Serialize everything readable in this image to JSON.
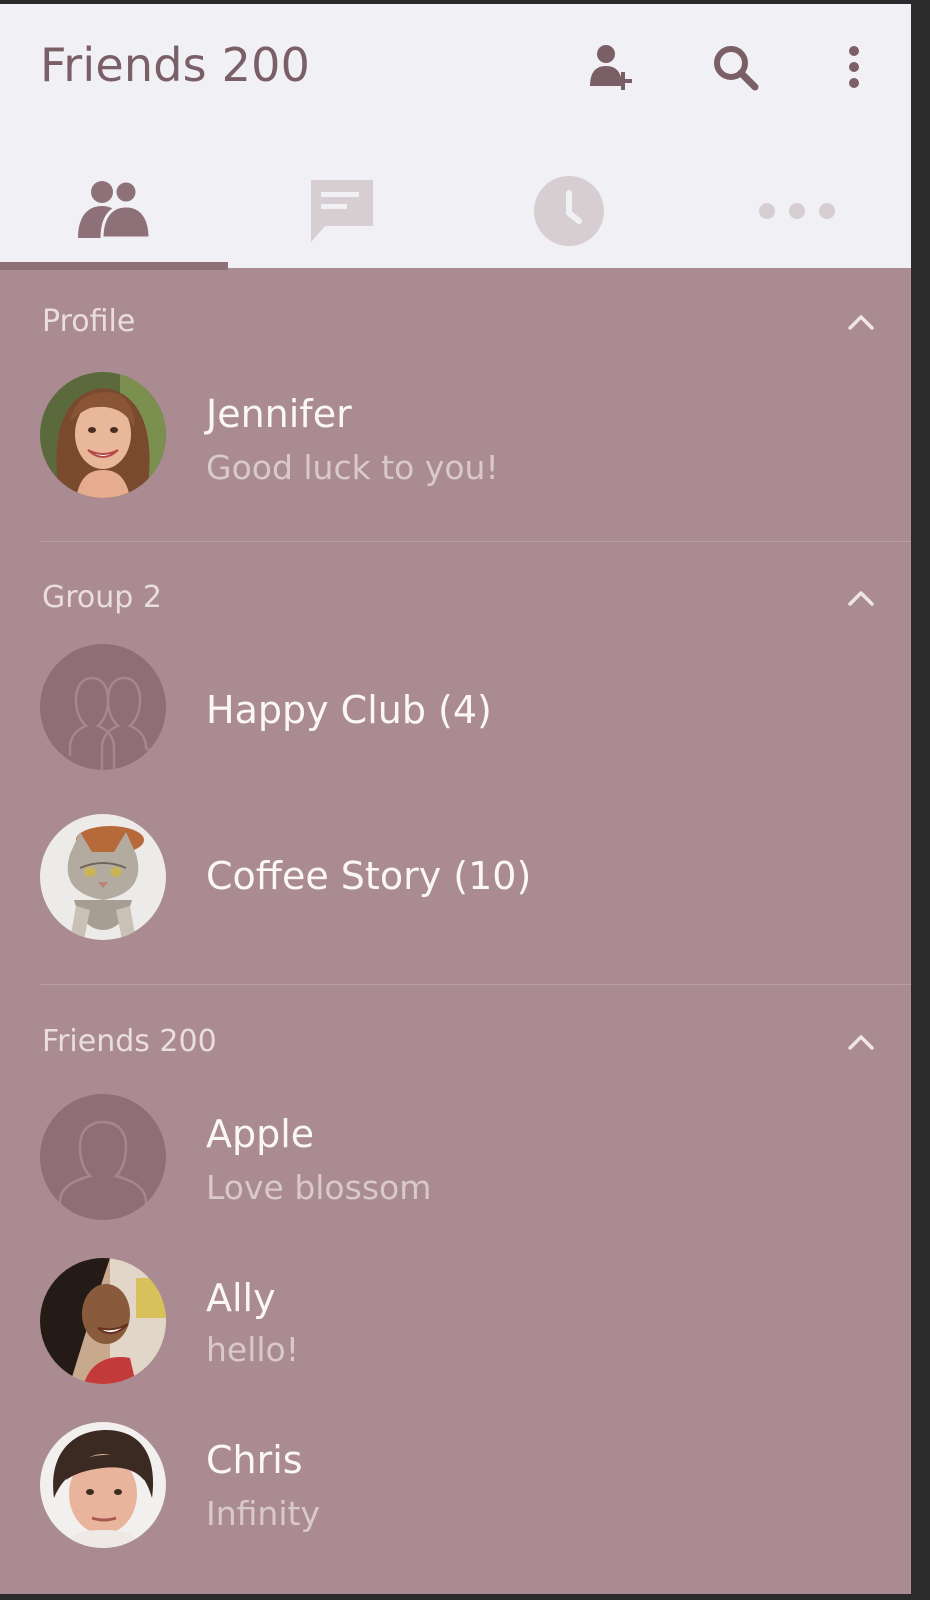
{
  "header": {
    "title": "Friends 200",
    "icons": [
      "add-friend-icon",
      "search-icon",
      "overflow-menu-icon"
    ]
  },
  "tabs": [
    {
      "icon": "friends-icon",
      "selected": true
    },
    {
      "icon": "chat-icon",
      "selected": false
    },
    {
      "icon": "clock-icon",
      "selected": false
    },
    {
      "icon": "more-icon",
      "selected": false
    }
  ],
  "sections": {
    "profile": {
      "header": "Profile",
      "items": [
        {
          "name": "Jennifer",
          "status": "Good luck to you!"
        }
      ]
    },
    "groups": {
      "header": "Group 2",
      "items": [
        {
          "name": "Happy Club (4)"
        },
        {
          "name": "Coffee Story (10)"
        }
      ]
    },
    "friends": {
      "header": "Friends 200",
      "items": [
        {
          "name": "Apple",
          "status": "Love blossom"
        },
        {
          "name": "Ally",
          "status": "hello!"
        },
        {
          "name": "Chris",
          "status": "Infinity"
        }
      ]
    }
  },
  "colors": {
    "background": "#a98b91",
    "topbar": "#f1f0f4",
    "accent": "#8e7078",
    "icon_inactive": "#d6ced1"
  }
}
